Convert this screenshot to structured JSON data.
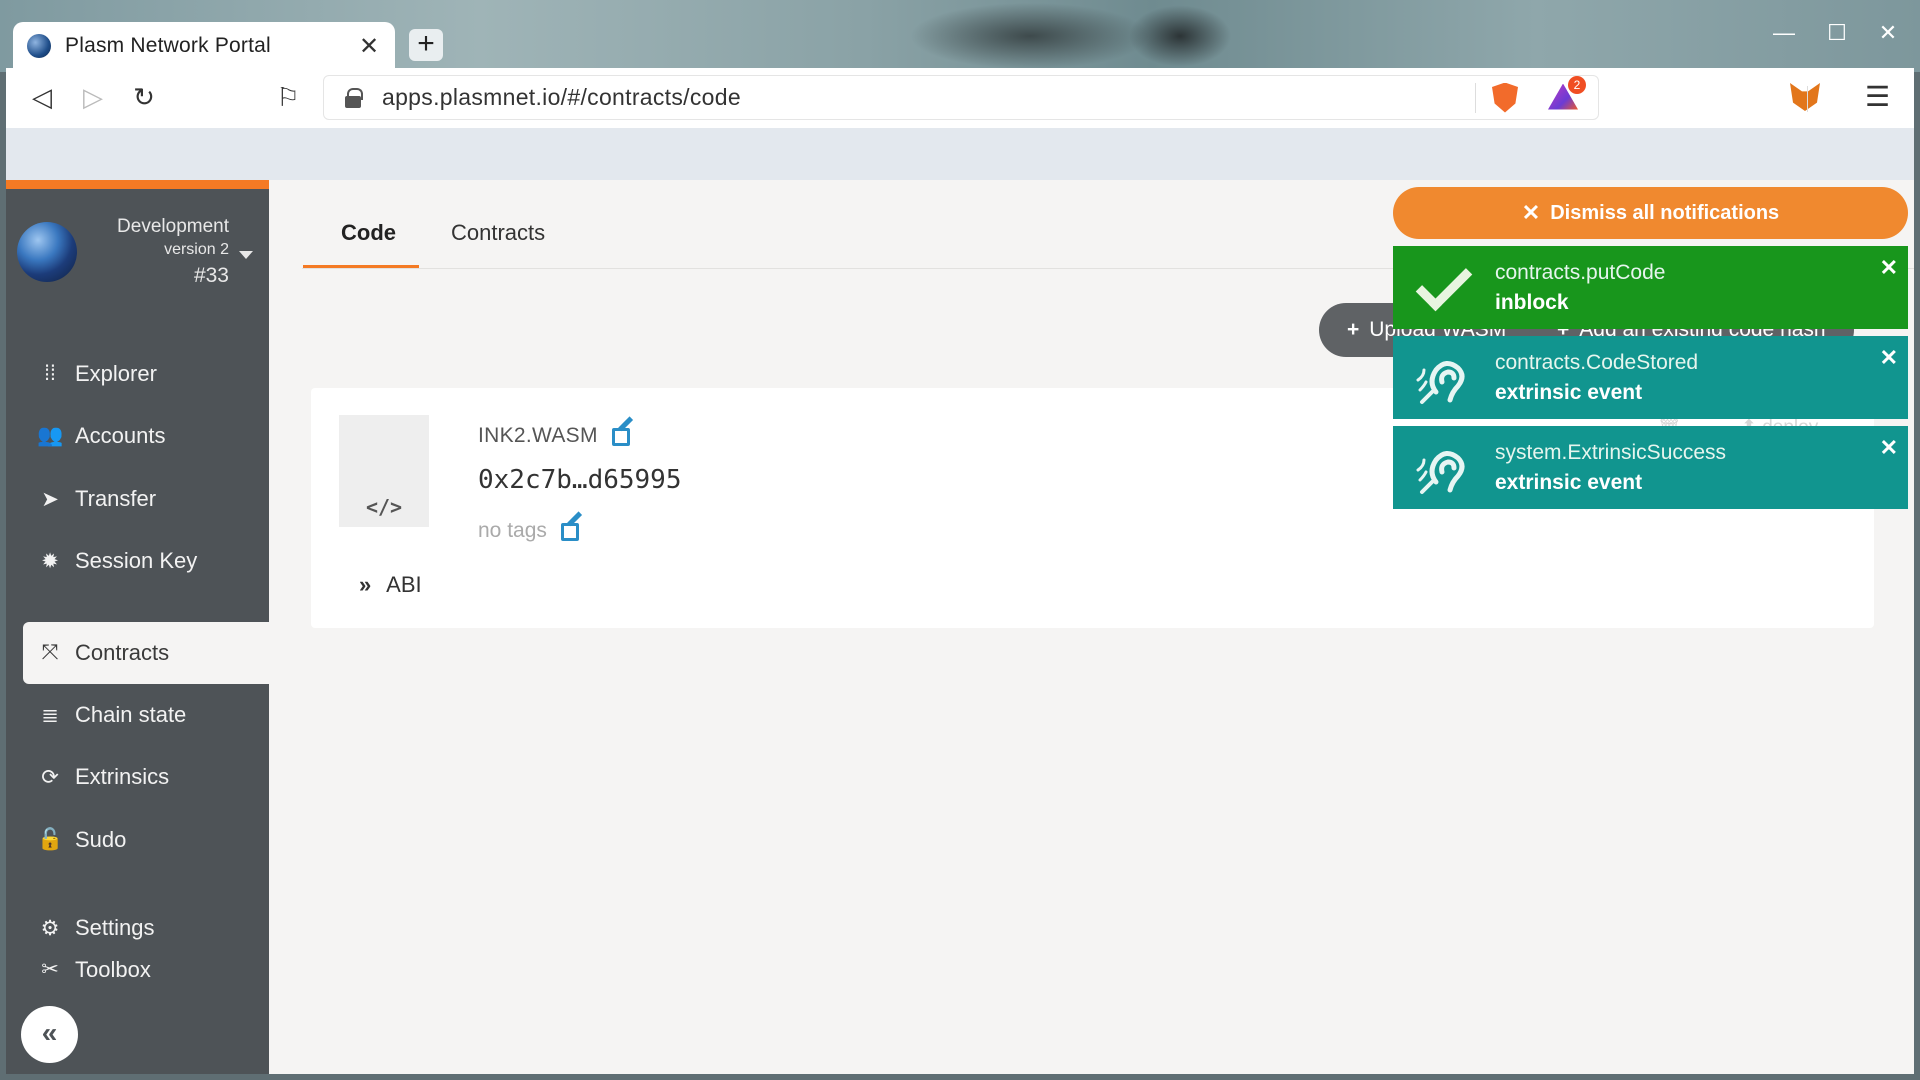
{
  "browser": {
    "tab_title": "Plasm Network Portal",
    "tab_close": "✕",
    "new_tab": "+",
    "url": "apps.plasmnet.io/#/contracts/code",
    "rewards_badge": "2",
    "window_controls": [
      "—",
      "☐",
      "✕"
    ]
  },
  "chain": {
    "name": "Development",
    "version": "version 2",
    "block": "#33"
  },
  "sidebar": {
    "items": [
      {
        "label": "Explorer",
        "icon": "explorer-icon",
        "glyph": "⁞⁞"
      },
      {
        "label": "Accounts",
        "icon": "users-icon",
        "glyph": "👥"
      },
      {
        "label": "Transfer",
        "icon": "paper-plane-icon",
        "glyph": "➤"
      },
      {
        "label": "Session Key",
        "icon": "certificate-icon",
        "glyph": "✹"
      },
      {
        "label": "Contracts",
        "icon": "compress-icon",
        "glyph": "⤧"
      },
      {
        "label": "Chain state",
        "icon": "database-icon",
        "glyph": "≣"
      },
      {
        "label": "Extrinsics",
        "icon": "sync-icon",
        "glyph": "⟳"
      },
      {
        "label": "Sudo",
        "icon": "unlock-icon",
        "glyph": "🔓"
      },
      {
        "label": "Settings",
        "icon": "cogs-icon",
        "glyph": "⚙"
      },
      {
        "label": "Toolbox",
        "icon": "tools-icon",
        "glyph": "✂"
      }
    ],
    "collapse": "«"
  },
  "tabs": {
    "code": "Code",
    "contracts": "Contracts"
  },
  "actions": {
    "upload_wasm": "Upload WASM",
    "add_code_hash": "Add an existing code hash"
  },
  "code_card": {
    "name": "INK2.WASM",
    "hash": "0x2c7b…d65995",
    "tags": "no tags",
    "abi_label": "ABI",
    "abi_chevron": "»",
    "thumb_glyph": "</>",
    "deploy_label": "deploy"
  },
  "notifications": {
    "dismiss_all": "Dismiss all notifications",
    "dismiss_glyph": "✕",
    "items": [
      {
        "title": "contracts.putCode",
        "status": "inblock",
        "kind": "success"
      },
      {
        "title": "contracts.CodeStored",
        "status": "extrinsic event",
        "kind": "event"
      },
      {
        "title": "system.ExtrinsicSuccess",
        "status": "extrinsic event",
        "kind": "event"
      }
    ]
  },
  "colors": {
    "accent": "#f47a24",
    "sidebar": "#4e5357",
    "success": "#18961c",
    "event": "#11958f",
    "link": "#2a8ec7"
  }
}
